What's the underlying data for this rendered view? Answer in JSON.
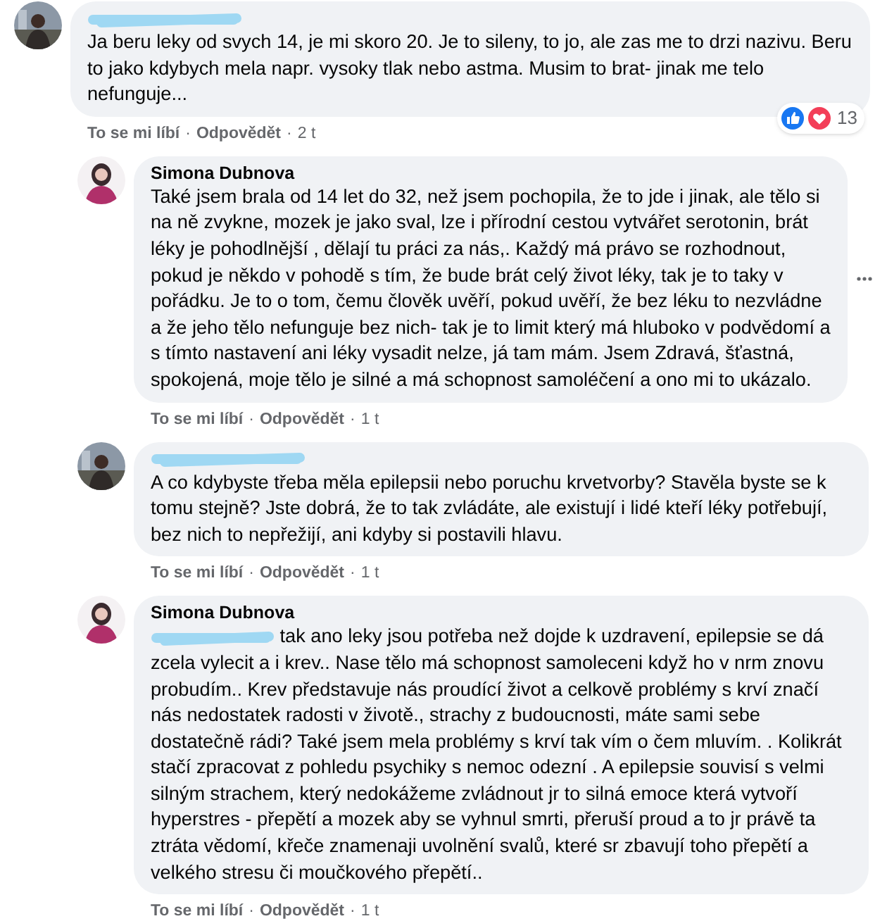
{
  "separator": "·",
  "comments": [
    {
      "kind": "comment",
      "name_redacted": true,
      "text": "Ja beru leky od svych 14, je mi skoro 20. Je to sileny, to jo, ale zas me to drzi nazivu. Beru to jako kdybych mela napr. vysoky tlak nebo astma. Musim to brat- jinak me telo nefunguje...",
      "like": "To se mi líbí",
      "reply": "Odpovědět",
      "time": "2 t",
      "reactions": "13"
    },
    {
      "kind": "reply",
      "author": "Simona Dubnova",
      "text": "Také jsem brala od 14 let do 32, než jsem pochopila, že to jde i jinak, ale tělo si na ně zvykne, mozek je jako sval, lze i přírodní cestou vytvářet serotonin, brát léky je pohodlnější , dělají tu práci za nás,. Každý má právo se rozhodnout, pokud je někdo v pohodě s tím, že bude brát celý život léky, tak je to taky v pořádku. Je to o tom, čemu člověk uvěří, pokud uvěří, že bez léku to nezvládne a že jeho tělo nefunguje bez nich- tak je to limit který má hluboko v podvědomí a s tímto nastavení ani léky vysadit nelze, já tam mám. Jsem Zdravá, šťastná, spokojená, moje tělo je silné a má schopnost samoléčení a ono mi to ukázalo.",
      "like": "To se mi líbí",
      "reply": "Odpovědět",
      "time": "1 t",
      "more": true
    },
    {
      "kind": "reply",
      "name_redacted": true,
      "text": "A co kdybyste třeba měla epilepsii nebo poruchu krvetvorby? Stavěla byste se k tomu stejně? Jste dobrá, že to tak zvládáte, ale existují i lidé kteří léky potřebují, bez nich to nepřežijí, ani kdyby si postavili hlavu.",
      "like": "To se mi líbí",
      "reply": "Odpovědět",
      "time": "1 t"
    },
    {
      "kind": "reply",
      "author": "Simona Dubnova",
      "mention_redacted": true,
      "text": "tak ano leky jsou potřeba než dojde k uzdravení, epilepsie se dá zcela vylecit a i krev.. Nase tělo má schopnost samoleceni když ho v nrm znovu probudím.. Krev představuje nás proudící život a celkově problémy s krví značí nás nedostatek radosti v životě., strachy z budoucnosti, máte sami sebe dostatečně rádi? Také jsem mela problémy s krví tak vím o čem mluvím. . Kolikrát stačí zpracovat z pohledu psychiky s nemoc odezní . A epilepsie souvisí s velmi silným strachem, který nedokážeme zvládnout jr to silná emoce která vytvoří hyperstres - přepětí a mozek aby se vyhnul smrti, přeruší proud a to jr právě ta ztráta vědomí, křeče znamenaji uvolnění svalů, které sr zbavují toho přepětí a velkého stresu či moučkového přepětí..",
      "like": "To se mi líbí",
      "reply": "Odpovědět",
      "time": "1 t"
    }
  ]
}
